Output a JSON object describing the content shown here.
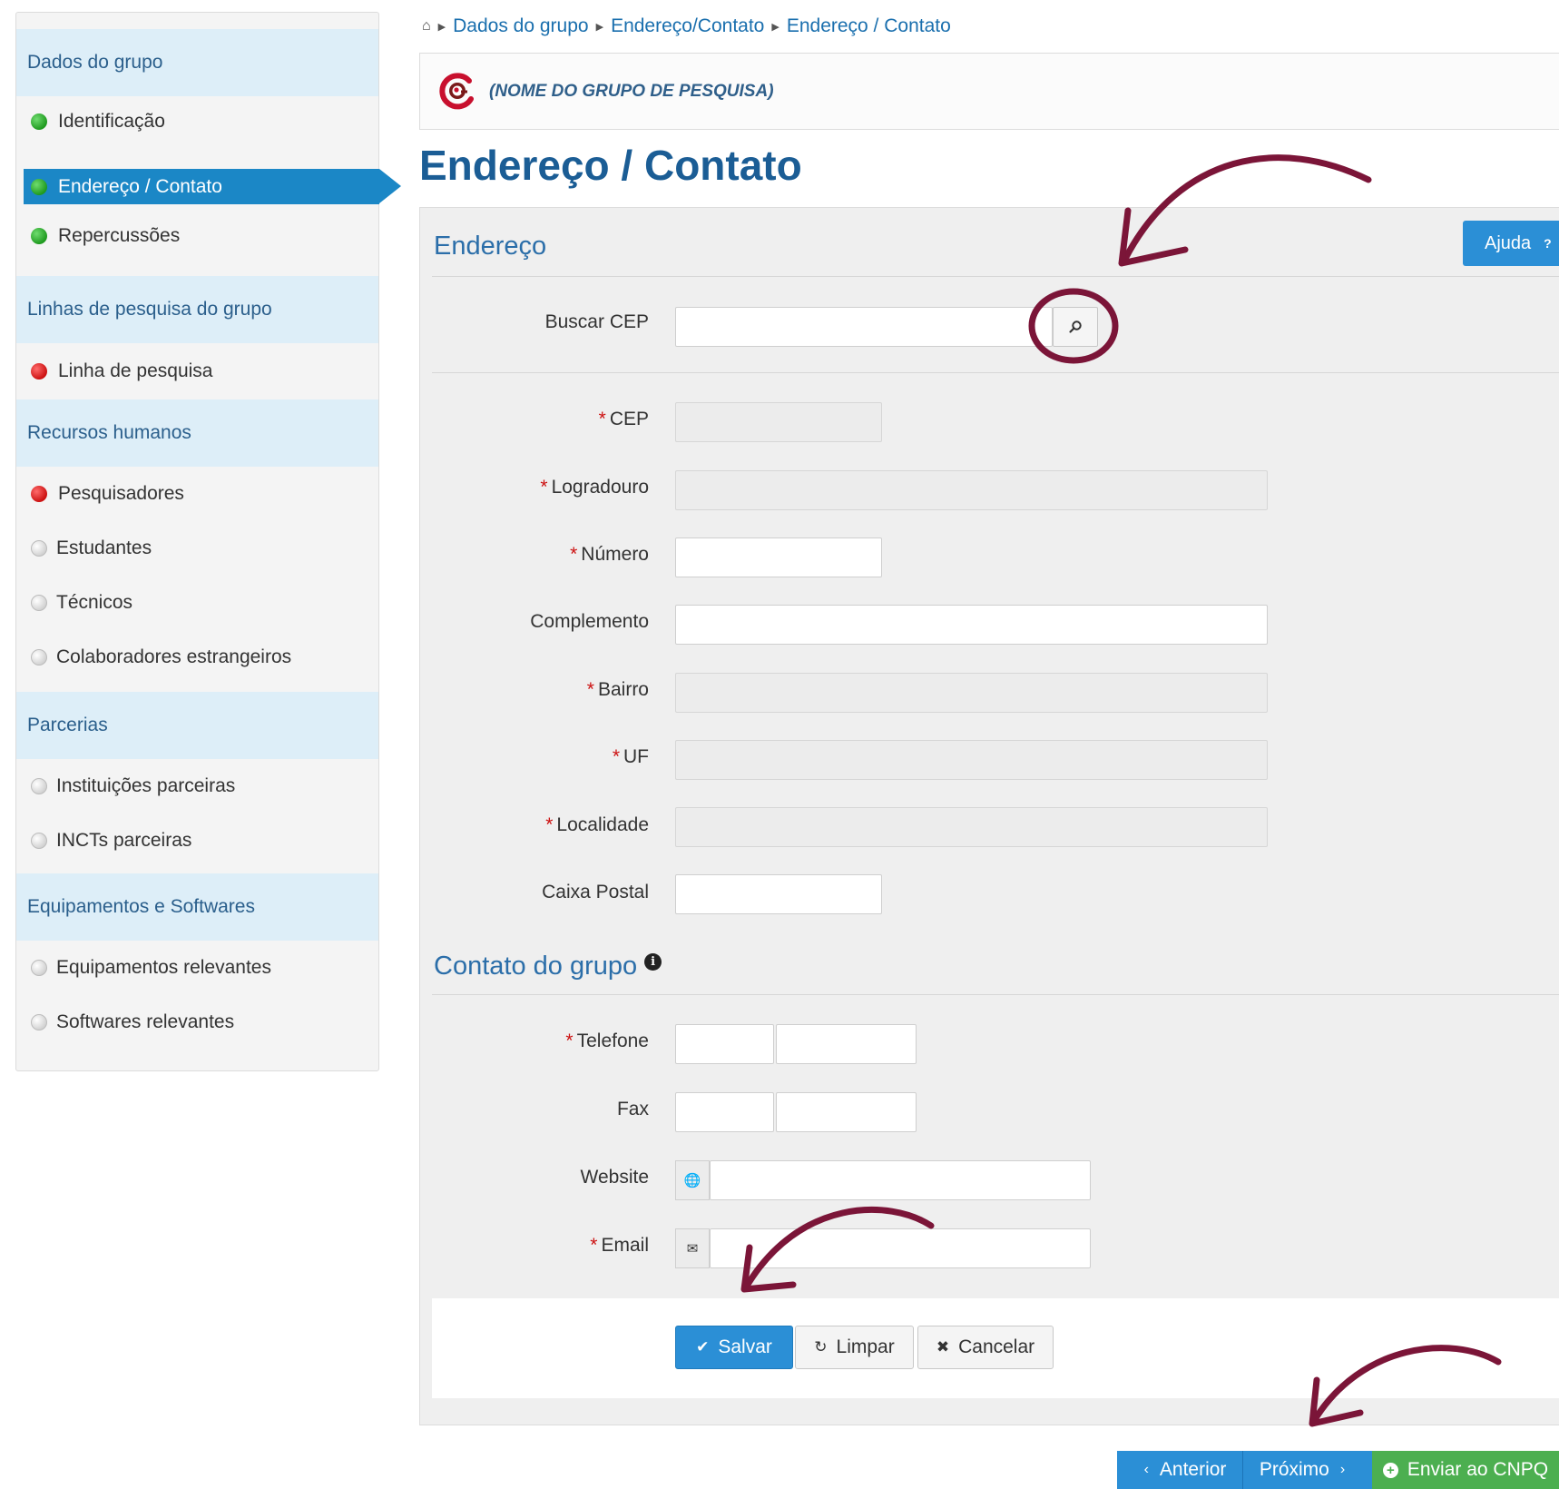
{
  "sidebar": {
    "sections": [
      {
        "title": "Dados do grupo",
        "items": [
          {
            "label": "Identificação",
            "status": "green"
          },
          {
            "label": "Endereço / Contato",
            "status": "green",
            "active": true
          },
          {
            "label": "Repercussões",
            "status": "green"
          }
        ]
      },
      {
        "title": "Linhas de pesquisa do grupo",
        "items": [
          {
            "label": "Linha de pesquisa",
            "status": "red"
          }
        ]
      },
      {
        "title": "Recursos humanos",
        "items": [
          {
            "label": "Pesquisadores",
            "status": "red"
          },
          {
            "label": "Estudantes",
            "status": "gray"
          },
          {
            "label": "Técnicos",
            "status": "gray"
          },
          {
            "label": "Colaboradores estrangeiros",
            "status": "gray"
          }
        ]
      },
      {
        "title": "Parcerias",
        "items": [
          {
            "label": "Instituições parceiras",
            "status": "gray"
          },
          {
            "label": "INCTs parceiras",
            "status": "gray"
          }
        ]
      },
      {
        "title": "Equipamentos e Softwares",
        "items": [
          {
            "label": "Equipamentos relevantes",
            "status": "gray"
          },
          {
            "label": "Softwares relevantes",
            "status": "gray"
          }
        ]
      }
    ]
  },
  "breadcrumb": [
    "Dados do grupo",
    "Endereço/Contato",
    "Endereço / Contato"
  ],
  "group": {
    "name": "(NOME DO GRUPO DE PESQUISA)"
  },
  "page_title": "Endereço / Contato",
  "help_label": "Ajuda",
  "endereco": {
    "title": "Endereço",
    "buscar_cep": "Buscar CEP",
    "cep": "CEP",
    "logradouro": "Logradouro",
    "numero": "Número",
    "complemento": "Complemento",
    "bairro": "Bairro",
    "uf": "UF",
    "localidade": "Localidade",
    "caixa_postal": "Caixa Postal"
  },
  "contato": {
    "title": "Contato do grupo",
    "telefone": "Telefone",
    "fax": "Fax",
    "website": "Website",
    "email": "Email"
  },
  "actions": {
    "save": "Salvar",
    "clear": "Limpar",
    "cancel": "Cancelar"
  },
  "nav": {
    "prev": "Anterior",
    "next": "Próximo",
    "send": "Enviar ao CNPQ"
  },
  "colors": {
    "primary": "#2b8fd6",
    "active": "#1b87c6",
    "success": "#4caf50",
    "annotation": "#7b1538"
  }
}
